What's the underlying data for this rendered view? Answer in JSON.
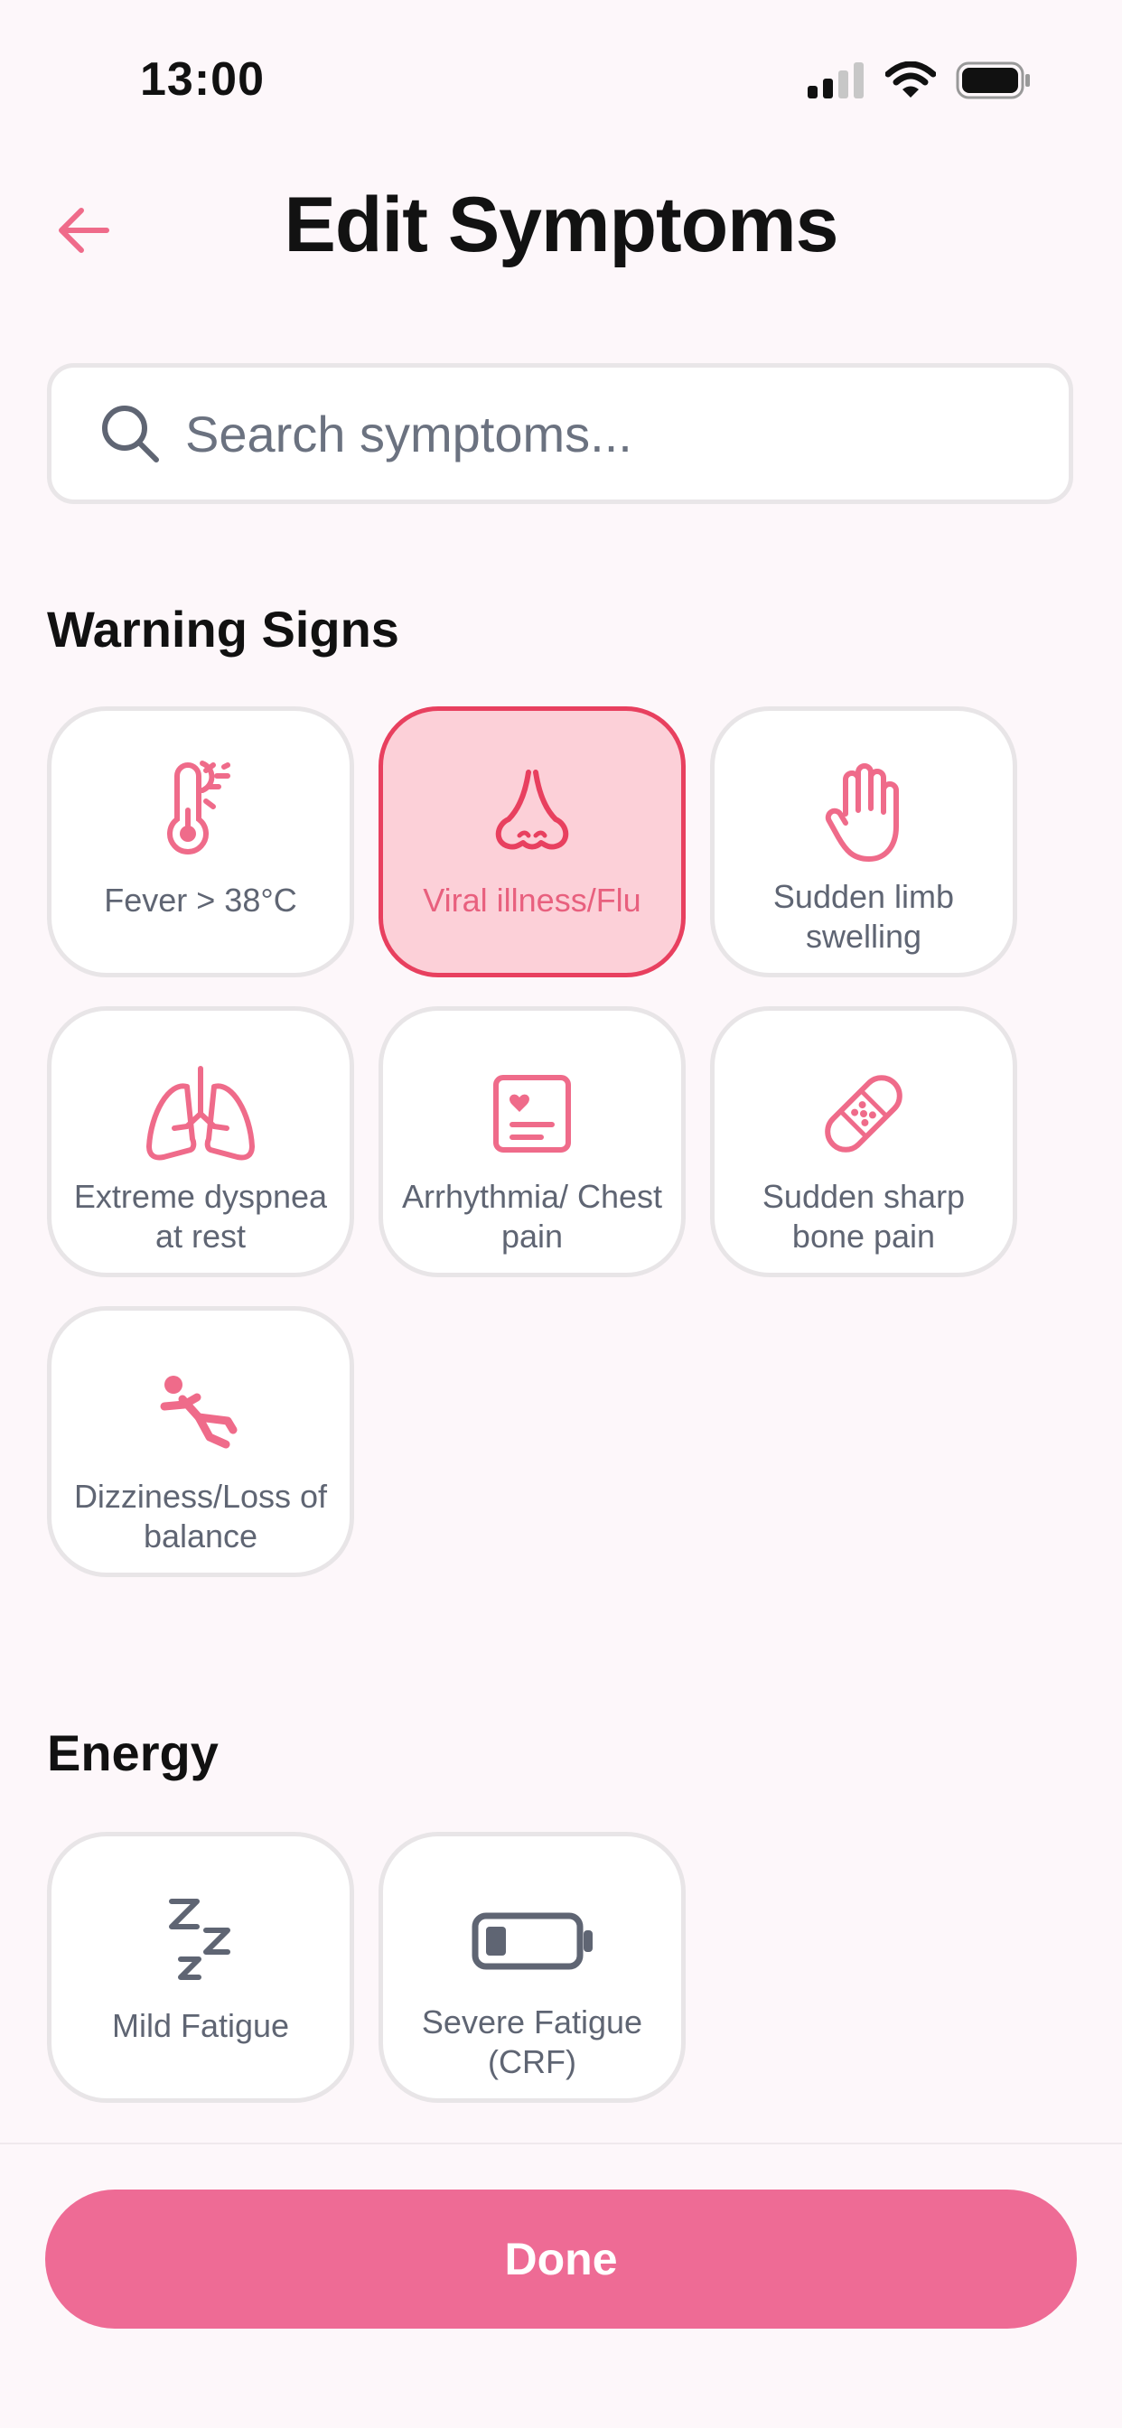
{
  "status_bar": {
    "time": "13:00"
  },
  "header": {
    "title": "Edit Symptoms",
    "back_icon": "arrow-left-icon"
  },
  "search": {
    "placeholder": "Search symptoms..."
  },
  "colors": {
    "accent": "#ee6b95",
    "icon_pink": "#ef6b8a",
    "selected_bg": "#fcd0d8",
    "selected_border": "#e8405f",
    "icon_gray": "#5f6573"
  },
  "sections": {
    "warning": {
      "title": "Warning Signs",
      "items": [
        {
          "label": "Fever > 38°C",
          "icon": "thermometer-sun-icon",
          "selected": false
        },
        {
          "label": "Viral illness/Flu",
          "icon": "nose-icon",
          "selected": true
        },
        {
          "label": "Sudden limb swelling",
          "icon": "hand-icon",
          "selected": false
        },
        {
          "label": "Extreme dyspnea at rest",
          "icon": "lungs-icon",
          "selected": false
        },
        {
          "label": "Arrhythmia/ Chest pain",
          "icon": "heart-card-icon",
          "selected": false
        },
        {
          "label": "Sudden sharp bone pain",
          "icon": "bandage-icon",
          "selected": false
        },
        {
          "label": "Dizziness/Loss of balance",
          "icon": "falling-person-icon",
          "selected": false
        }
      ]
    },
    "energy": {
      "title": "Energy",
      "items": [
        {
          "label": "Mild Fatigue",
          "icon": "zzz-icon",
          "selected": false
        },
        {
          "label": "Severe Fatigue (CRF)",
          "icon": "battery-low-icon",
          "selected": false
        }
      ]
    }
  },
  "footer": {
    "done_label": "Done"
  }
}
